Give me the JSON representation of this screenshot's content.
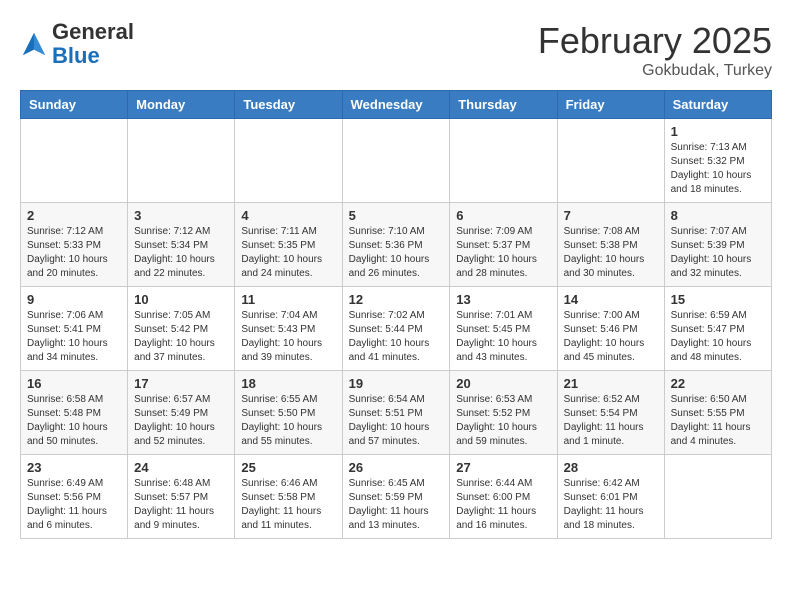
{
  "header": {
    "logo_general": "General",
    "logo_blue": "Blue",
    "month": "February 2025",
    "location": "Gokbudak, Turkey"
  },
  "weekdays": [
    "Sunday",
    "Monday",
    "Tuesday",
    "Wednesday",
    "Thursday",
    "Friday",
    "Saturday"
  ],
  "weeks": [
    [
      {
        "day": "",
        "info": ""
      },
      {
        "day": "",
        "info": ""
      },
      {
        "day": "",
        "info": ""
      },
      {
        "day": "",
        "info": ""
      },
      {
        "day": "",
        "info": ""
      },
      {
        "day": "",
        "info": ""
      },
      {
        "day": "1",
        "info": "Sunrise: 7:13 AM\nSunset: 5:32 PM\nDaylight: 10 hours\nand 18 minutes."
      }
    ],
    [
      {
        "day": "2",
        "info": "Sunrise: 7:12 AM\nSunset: 5:33 PM\nDaylight: 10 hours\nand 20 minutes."
      },
      {
        "day": "3",
        "info": "Sunrise: 7:12 AM\nSunset: 5:34 PM\nDaylight: 10 hours\nand 22 minutes."
      },
      {
        "day": "4",
        "info": "Sunrise: 7:11 AM\nSunset: 5:35 PM\nDaylight: 10 hours\nand 24 minutes."
      },
      {
        "day": "5",
        "info": "Sunrise: 7:10 AM\nSunset: 5:36 PM\nDaylight: 10 hours\nand 26 minutes."
      },
      {
        "day": "6",
        "info": "Sunrise: 7:09 AM\nSunset: 5:37 PM\nDaylight: 10 hours\nand 28 minutes."
      },
      {
        "day": "7",
        "info": "Sunrise: 7:08 AM\nSunset: 5:38 PM\nDaylight: 10 hours\nand 30 minutes."
      },
      {
        "day": "8",
        "info": "Sunrise: 7:07 AM\nSunset: 5:39 PM\nDaylight: 10 hours\nand 32 minutes."
      }
    ],
    [
      {
        "day": "9",
        "info": "Sunrise: 7:06 AM\nSunset: 5:41 PM\nDaylight: 10 hours\nand 34 minutes."
      },
      {
        "day": "10",
        "info": "Sunrise: 7:05 AM\nSunset: 5:42 PM\nDaylight: 10 hours\nand 37 minutes."
      },
      {
        "day": "11",
        "info": "Sunrise: 7:04 AM\nSunset: 5:43 PM\nDaylight: 10 hours\nand 39 minutes."
      },
      {
        "day": "12",
        "info": "Sunrise: 7:02 AM\nSunset: 5:44 PM\nDaylight: 10 hours\nand 41 minutes."
      },
      {
        "day": "13",
        "info": "Sunrise: 7:01 AM\nSunset: 5:45 PM\nDaylight: 10 hours\nand 43 minutes."
      },
      {
        "day": "14",
        "info": "Sunrise: 7:00 AM\nSunset: 5:46 PM\nDaylight: 10 hours\nand 45 minutes."
      },
      {
        "day": "15",
        "info": "Sunrise: 6:59 AM\nSunset: 5:47 PM\nDaylight: 10 hours\nand 48 minutes."
      }
    ],
    [
      {
        "day": "16",
        "info": "Sunrise: 6:58 AM\nSunset: 5:48 PM\nDaylight: 10 hours\nand 50 minutes."
      },
      {
        "day": "17",
        "info": "Sunrise: 6:57 AM\nSunset: 5:49 PM\nDaylight: 10 hours\nand 52 minutes."
      },
      {
        "day": "18",
        "info": "Sunrise: 6:55 AM\nSunset: 5:50 PM\nDaylight: 10 hours\nand 55 minutes."
      },
      {
        "day": "19",
        "info": "Sunrise: 6:54 AM\nSunset: 5:51 PM\nDaylight: 10 hours\nand 57 minutes."
      },
      {
        "day": "20",
        "info": "Sunrise: 6:53 AM\nSunset: 5:52 PM\nDaylight: 10 hours\nand 59 minutes."
      },
      {
        "day": "21",
        "info": "Sunrise: 6:52 AM\nSunset: 5:54 PM\nDaylight: 11 hours\nand 1 minute."
      },
      {
        "day": "22",
        "info": "Sunrise: 6:50 AM\nSunset: 5:55 PM\nDaylight: 11 hours\nand 4 minutes."
      }
    ],
    [
      {
        "day": "23",
        "info": "Sunrise: 6:49 AM\nSunset: 5:56 PM\nDaylight: 11 hours\nand 6 minutes."
      },
      {
        "day": "24",
        "info": "Sunrise: 6:48 AM\nSunset: 5:57 PM\nDaylight: 11 hours\nand 9 minutes."
      },
      {
        "day": "25",
        "info": "Sunrise: 6:46 AM\nSunset: 5:58 PM\nDaylight: 11 hours\nand 11 minutes."
      },
      {
        "day": "26",
        "info": "Sunrise: 6:45 AM\nSunset: 5:59 PM\nDaylight: 11 hours\nand 13 minutes."
      },
      {
        "day": "27",
        "info": "Sunrise: 6:44 AM\nSunset: 6:00 PM\nDaylight: 11 hours\nand 16 minutes."
      },
      {
        "day": "28",
        "info": "Sunrise: 6:42 AM\nSunset: 6:01 PM\nDaylight: 11 hours\nand 18 minutes."
      },
      {
        "day": "",
        "info": ""
      }
    ]
  ]
}
